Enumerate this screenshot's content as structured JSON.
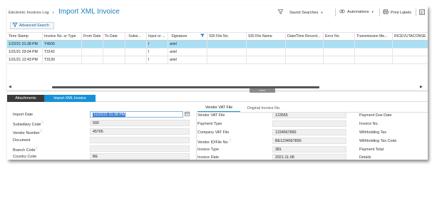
{
  "header": {
    "breadcrumb": "Electronic Invoices Log",
    "separator": "»",
    "title": "Import XML Invoice",
    "saved_searches": "Saved Searches",
    "automations": "Automations",
    "print_labels": "Print Labels"
  },
  "toolbar": {
    "advanced_search": "Advanced Search"
  },
  "grid": {
    "columns": [
      "Time Stamp",
      "Invoice No. or Type",
      "From Date",
      "To Date",
      "Subsi...",
      "Input or ...",
      "Signature",
      "SDI File No.",
      "SDI File Name",
      "Date/Time Record...",
      "Error No.",
      "Transmission Me...",
      "RICEVUTACONSE"
    ],
    "rows": [
      [
        "1/22/21 01:38 PM",
        "T4500",
        "",
        "",
        "",
        "I",
        "ariel",
        "",
        "",
        "",
        "",
        "",
        ""
      ],
      [
        "1/21/21 03:04 PM",
        "T3142",
        "",
        "",
        "",
        "I",
        "ariel",
        "",
        "",
        "",
        "",
        "",
        ""
      ],
      [
        "1/21/21 12:43 PM",
        "T3130",
        "",
        "",
        "",
        "I",
        "ariel",
        "",
        "",
        "",
        "",
        "",
        ""
      ]
    ],
    "selected_row": 0,
    "selection_color": "#a8dff5"
  },
  "tabs": {
    "attachments": "Attachments",
    "import_xml": "Import XML Invoice"
  },
  "form_left": {
    "import_date_label": "Import Date",
    "import_date_value": "11/22/21 01:38 PM",
    "subsidiary_code_label": "Subsidiary Code",
    "subsidiary_code_value": "000",
    "vendor_number_label": "Vendor Number",
    "vendor_number_value": "45765",
    "document_label": "Document",
    "document_value": "",
    "branch_code_label": "Branch Code",
    "branch_code_value": "",
    "country_code_label": "Country Code",
    "country_code_value": "BE"
  },
  "subtabs": {
    "vendor_vat": "Vendor VAT File",
    "original_invoice": "Original Invoice No."
  },
  "form_mid": {
    "vendor_vat_file_label": "Vendor VAT File",
    "vendor_vat_file_value": "123555",
    "payment_type_label": "Payment Type",
    "payment_type_value": "",
    "company_vat_file_label": "Company VAT File",
    "company_vat_file_value": "1234567890",
    "vendor_id_label": "Vendor ID/File No.",
    "vendor_id_value": "BE1234567890",
    "invoice_type_label": "Invoice Type",
    "invoice_type_value": "381",
    "invoice_date_label": "Invoice Date",
    "invoice_date_value": "2021-11-08"
  },
  "form_right": {
    "payment_due_date_label": "Payment Due Date",
    "invoice_no_label": "Invoice No.",
    "withholding_tax_label": "Withholding Tax",
    "withholding_tax_code_label": "Withholding Tax Code",
    "payment_total_label": "Payment Total",
    "details_label": "Details"
  },
  "colors": {
    "accent": "#1592d6",
    "title": "#1a7fc1",
    "dark_tab": "#3a3a3a"
  }
}
